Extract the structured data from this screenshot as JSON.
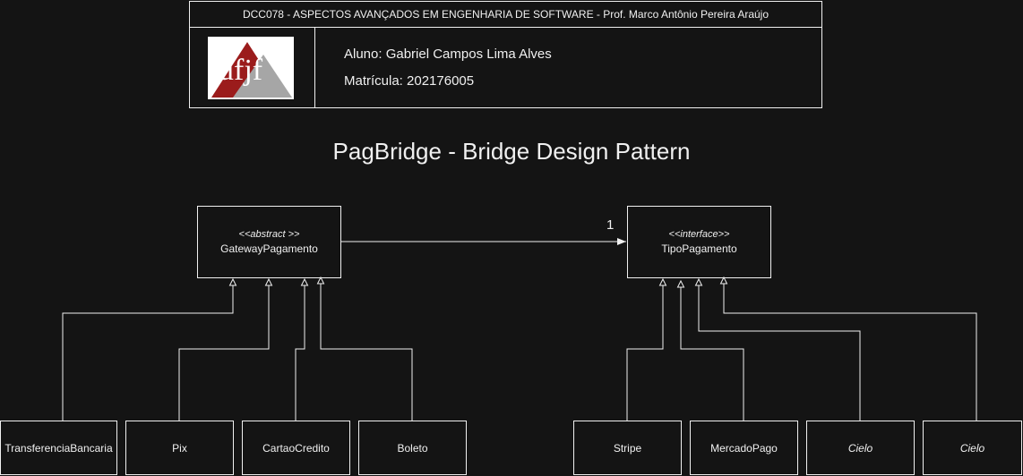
{
  "header": {
    "course": "DCC078 - ASPECTOS AVANÇADOS EM ENGENHARIA DE SOFTWARE - Prof. Marco Antônio Pereira Araújo",
    "logo_text": "ufjf",
    "student_name": "Aluno: Gabriel Campos Lima Alves",
    "student_id": "Matrícula: 202176005"
  },
  "diagram": {
    "title": "PagBridge -  Bridge Design Pattern",
    "abstraction": {
      "stereotype": "<<abstract >>",
      "name": "GatewayPagamento"
    },
    "implementor": {
      "stereotype": "<<interface>>",
      "name": "TipoPagamento"
    },
    "association_multiplicity": "1",
    "refined_abstractions": [
      "TransferenciaBancaria",
      "Pix",
      "CartaoCredito",
      "Boleto"
    ],
    "concrete_implementors": [
      "Stripe",
      "MercadoPago",
      "Cielo",
      "Cielo"
    ]
  },
  "colors": {
    "background": "#141414",
    "foreground": "#f0f0f0",
    "logo_red": "#9b1c1c",
    "logo_gray": "#a6a6a6"
  }
}
